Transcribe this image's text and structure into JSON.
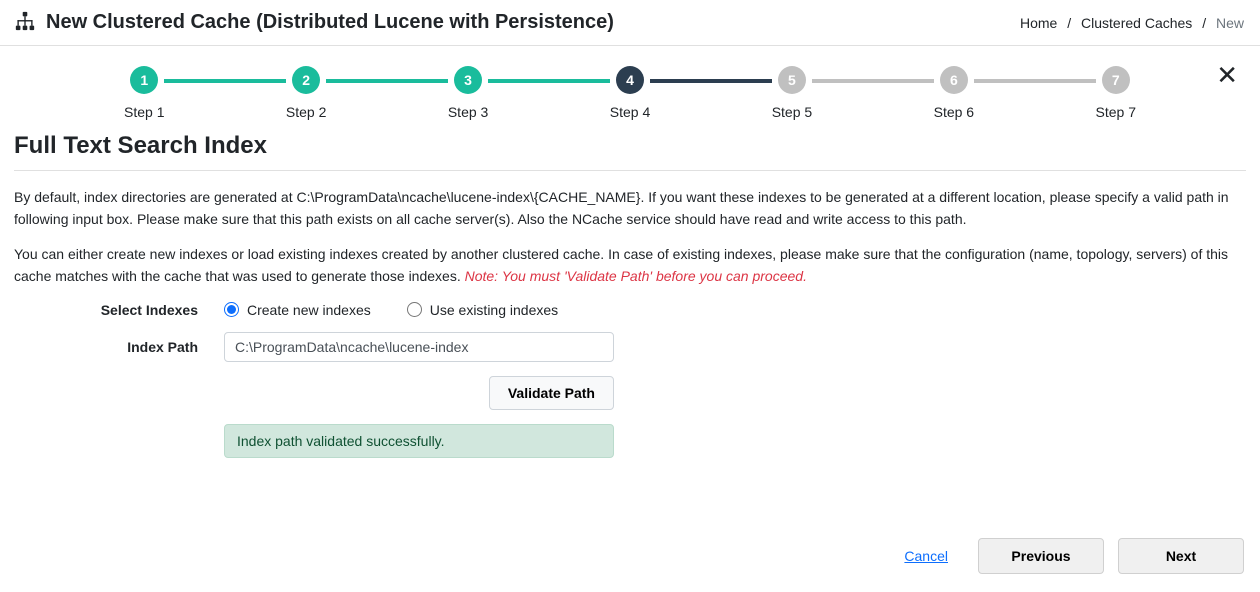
{
  "header": {
    "title": "New Clustered Cache (Distributed Lucene with Persistence)"
  },
  "breadcrumb": {
    "home": "Home",
    "middle": "Clustered Caches",
    "current": "New"
  },
  "stepper": {
    "steps": [
      {
        "num": "1",
        "label": "Step 1"
      },
      {
        "num": "2",
        "label": "Step 2"
      },
      {
        "num": "3",
        "label": "Step 3"
      },
      {
        "num": "4",
        "label": "Step 4"
      },
      {
        "num": "5",
        "label": "Step 5"
      },
      {
        "num": "6",
        "label": "Step 6"
      },
      {
        "num": "7",
        "label": "Step 7"
      }
    ]
  },
  "section_title": "Full Text Search Index",
  "para1": "By default, index directories are generated at C:\\ProgramData\\ncache\\lucene-index\\{CACHE_NAME}. If you want these indexes to be generated at a different location, please specify a valid path in following input box. Please make sure that this path exists on all cache server(s). Also the NCache service should have read and write access to this path.",
  "para2_main": "You can either create new indexes or load existing indexes created by another clustered cache. In case of existing indexes, please make sure that the configuration (name, topology, servers) of this cache matches with the cache that was used to generate those indexes. ",
  "para2_note": "Note: You must 'Validate Path' before you can proceed.",
  "form": {
    "select_indexes_label": "Select Indexes",
    "opt_create": "Create new indexes",
    "opt_existing": "Use existing indexes",
    "index_path_label": "Index Path",
    "index_path_value": "C:\\ProgramData\\ncache\\lucene-index",
    "validate_btn": "Validate Path",
    "success_msg": "Index path validated successfully."
  },
  "footer": {
    "cancel": "Cancel",
    "previous": "Previous",
    "next": "Next"
  }
}
